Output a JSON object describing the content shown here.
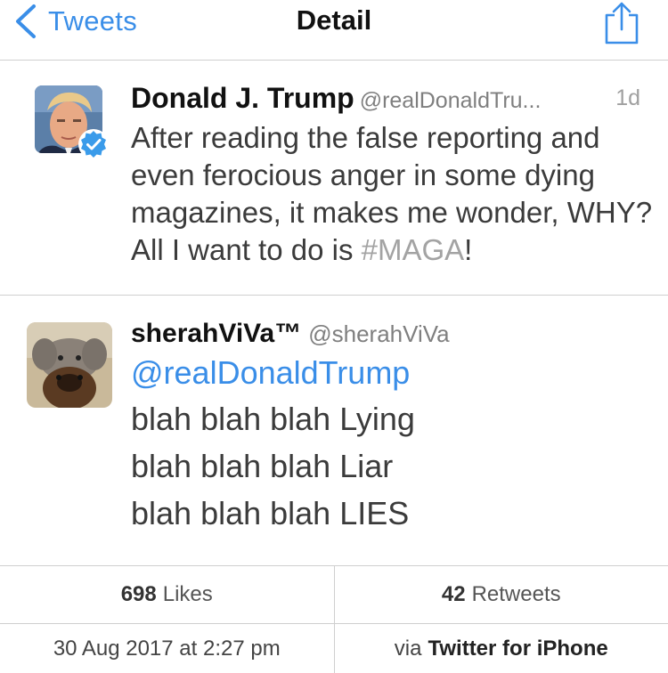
{
  "navbar": {
    "back_label": "Tweets",
    "title": "Detail",
    "icons": {
      "back": "chevron-left-icon",
      "share": "share-icon"
    },
    "accent_color": "#3a8ee8"
  },
  "tweet": {
    "author_name": "Donald J. Trump",
    "author_handle": "@realDonaldTru...",
    "time": "1d",
    "verified": true,
    "text_before_hashtag": "After reading the false reporting and even ferocious anger in some dying magazines, it makes me wonder, WHY? All I want to do is ",
    "hashtag": "#MAGA",
    "text_after_hashtag": "!"
  },
  "reply": {
    "author_name": "sherahViVa™",
    "author_handle": "@sherahViVa",
    "mention": "@realDonaldTrump",
    "lines": [
      "blah blah blah Lying",
      "blah blah blah Liar",
      "blah blah blah LIES"
    ]
  },
  "stats": {
    "likes_count": "698",
    "likes_label": "Likes",
    "retweets_count": "42",
    "retweets_label": "Retweets"
  },
  "meta": {
    "timestamp": "30 Aug 2017 at 2:27 pm",
    "via_prefix": "via",
    "via_app": "Twitter for iPhone"
  }
}
